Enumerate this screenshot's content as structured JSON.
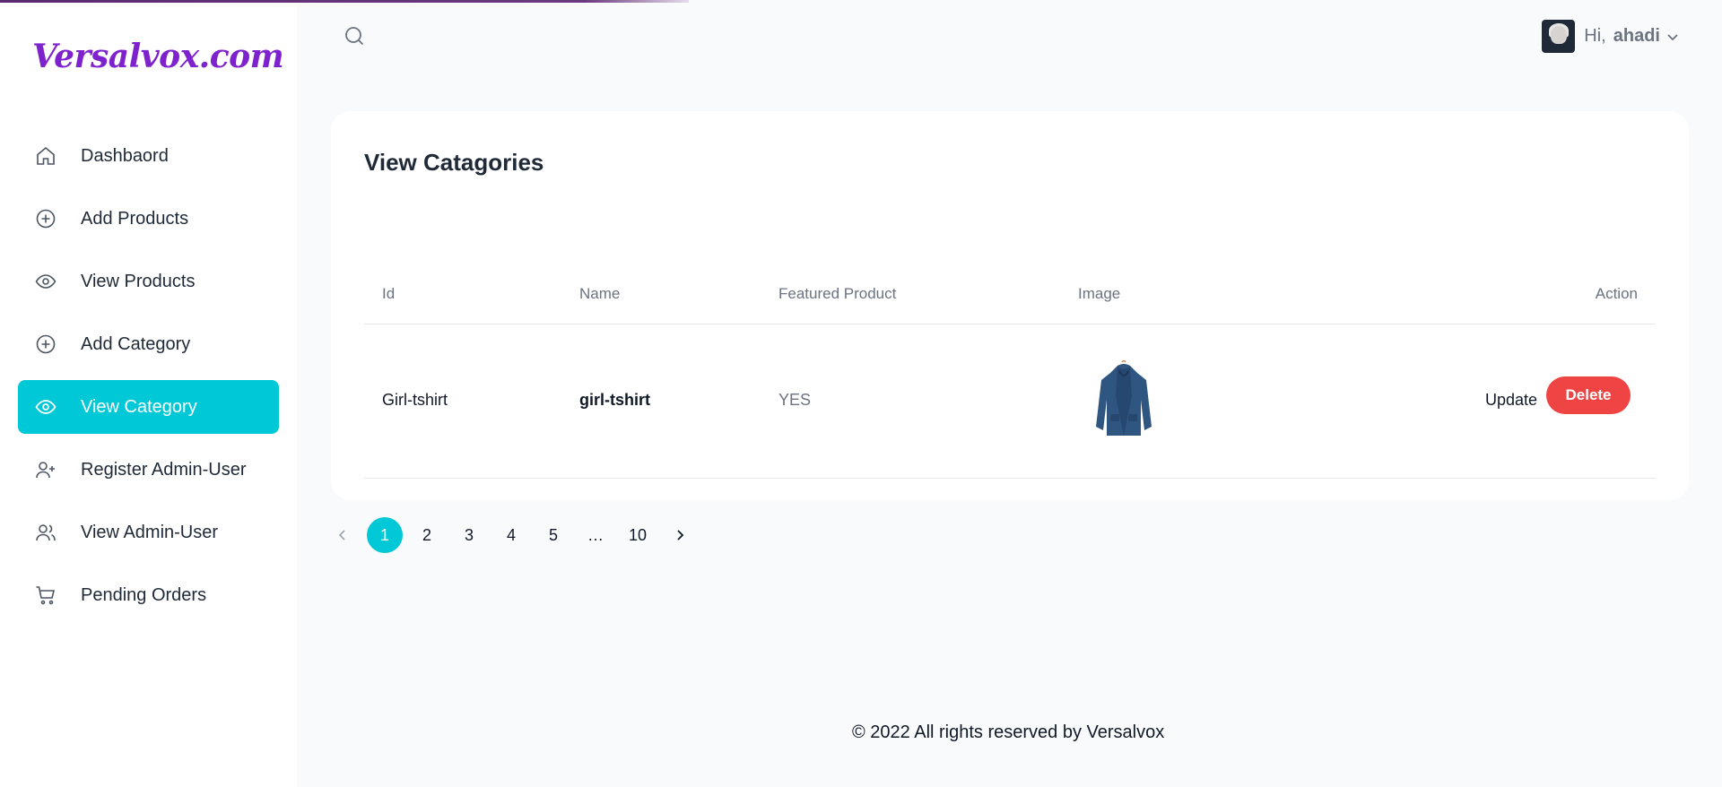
{
  "brand": {
    "logo_text": "Versalvox.com",
    "accent": "#00c8d7",
    "logo_color": "#7e22ce",
    "danger": "#ef4444"
  },
  "sidebar": {
    "items": [
      {
        "label": "Dashbaord",
        "icon": "home-icon"
      },
      {
        "label": "Add Products",
        "icon": "plus-circle-icon"
      },
      {
        "label": "View Products",
        "icon": "eye-icon"
      },
      {
        "label": "Add Category",
        "icon": "plus-circle-icon"
      },
      {
        "label": "View Category",
        "icon": "eye-icon",
        "active": true
      },
      {
        "label": "Register Admin-User",
        "icon": "user-plus-icon"
      },
      {
        "label": "View Admin-User",
        "icon": "users-icon"
      },
      {
        "label": "Pending Orders",
        "icon": "cart-icon"
      }
    ]
  },
  "header": {
    "greeting": "Hi,",
    "username": "ahadi"
  },
  "main": {
    "title": "View Catagories",
    "table": {
      "columns": [
        "Id",
        "Name",
        "Featured Product",
        "Image",
        "Action"
      ],
      "rows": [
        {
          "id": "Girl-tshirt",
          "name": "girl-tshirt",
          "featured": "YES",
          "image": "blue-jacket-image",
          "update_label": "Update",
          "delete_label": "Delete"
        }
      ]
    }
  },
  "pagination": {
    "pages": [
      "1",
      "2",
      "3",
      "4",
      "5",
      "…",
      "10"
    ],
    "current": "1"
  },
  "footer": {
    "text": "© 2022 All rights reserved by Versalvox"
  }
}
